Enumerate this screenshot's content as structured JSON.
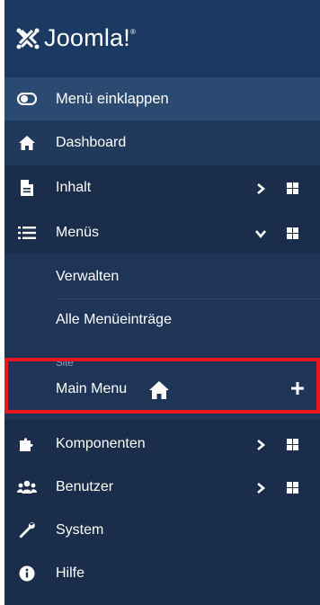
{
  "brand": {
    "name": "Joomla!",
    "registered": "®"
  },
  "sidebar": {
    "collapse_label": "Menü einklappen",
    "dashboard_label": "Dashboard",
    "items": [
      {
        "label": "Inhalt",
        "icon": "file-icon"
      },
      {
        "label": "Menüs",
        "icon": "list-icon",
        "expanded": true
      },
      {
        "label": "Komponenten",
        "icon": "puzzle-icon"
      },
      {
        "label": "Benutzer",
        "icon": "users-icon"
      },
      {
        "label": "System",
        "icon": "wrench-icon"
      },
      {
        "label": "Hilfe",
        "icon": "info-icon"
      }
    ],
    "menus_submenu": {
      "manage_label": "Verwalten",
      "all_items_label": "Alle Menüeinträge",
      "site_section_label": "Site",
      "main_menu_label": "Main Menu"
    }
  },
  "colors": {
    "sidebar_bg": "#1a2d4b",
    "logo_bg": "#1c3a61",
    "collapse_bg": "#2b4a72",
    "highlight_border": "#e8171f"
  }
}
